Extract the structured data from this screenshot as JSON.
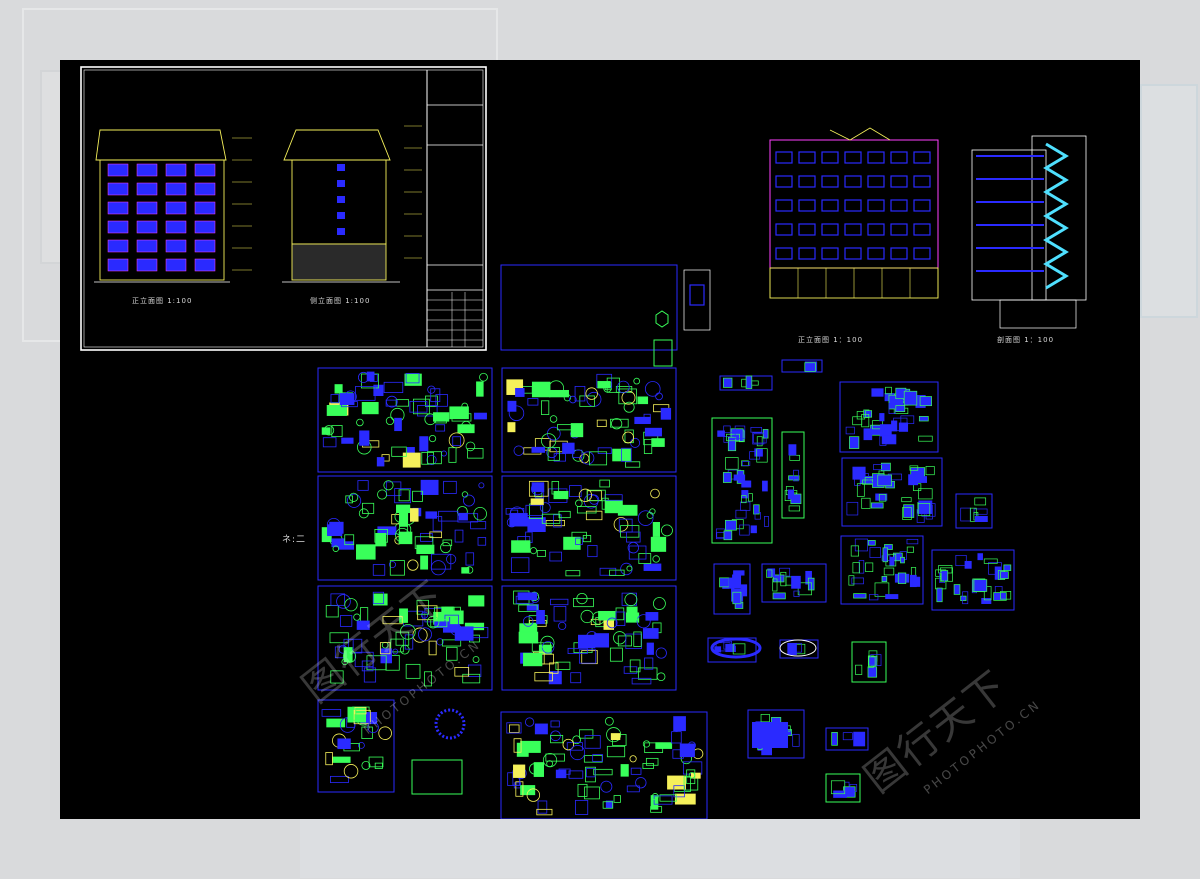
{
  "sheets": {
    "elevation_front_caption": "正立面图 1:100",
    "elevation_side_caption": "侧立面图 1:100",
    "elevation_right_caption": "正立面图 1：100",
    "section_caption": "剖面图 1：100",
    "left_marker": "ネ:二"
  },
  "watermarks": {
    "cn": "图行天下",
    "site": "PHOTOPHOTO.CN"
  },
  "colors": {
    "background": "#000000",
    "frame_white": "#ffffff",
    "line_blue": "#2a2aff",
    "line_green": "#39ff5a",
    "line_yellow": "#f5f05a",
    "line_cyan": "#4fe0ff",
    "line_magenta": "#ff40ff"
  }
}
